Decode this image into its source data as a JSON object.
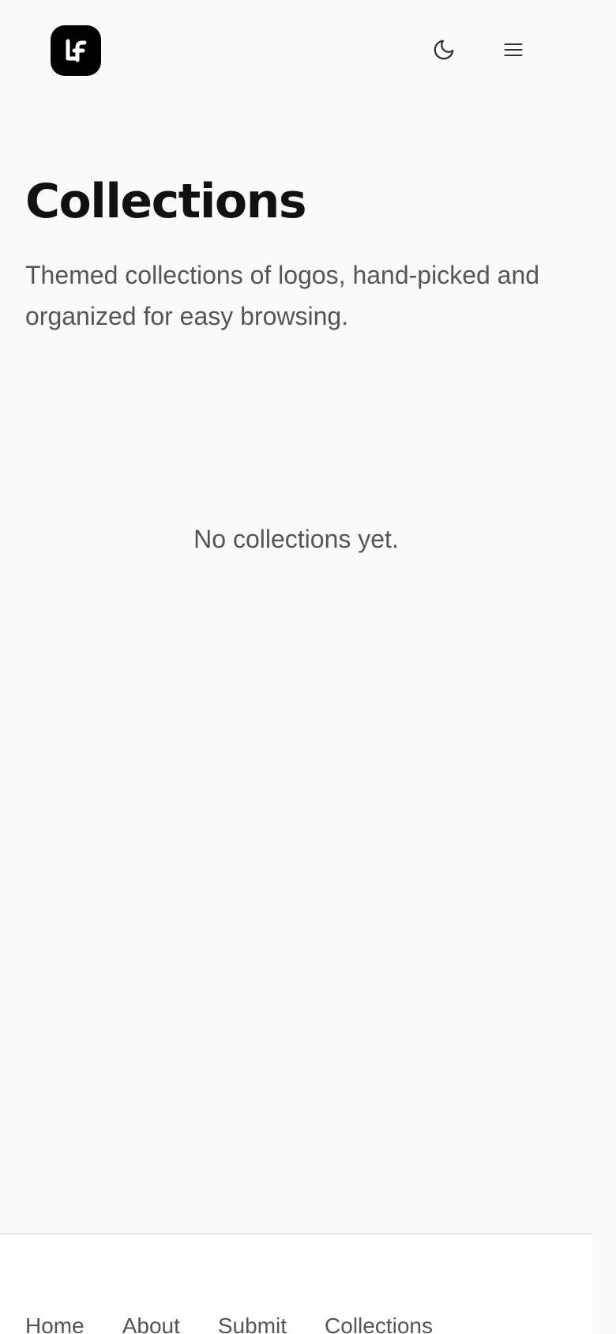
{
  "header": {
    "logo_text": "LF",
    "theme_toggle_icon": "moon-icon",
    "menu_icon": "hamburger-menu-icon"
  },
  "main": {
    "title": "Collections",
    "subtitle": "Themed collections of logos, hand-picked and organized for easy browsing.",
    "empty_message": "No collections yet."
  },
  "footer": {
    "links": [
      {
        "label": "Home"
      },
      {
        "label": "About"
      },
      {
        "label": "Submit"
      },
      {
        "label": "Collections"
      }
    ]
  },
  "colors": {
    "background": "#fafafa",
    "text_primary": "#111111",
    "text_secondary": "#555555",
    "logo_bg": "#000000"
  }
}
